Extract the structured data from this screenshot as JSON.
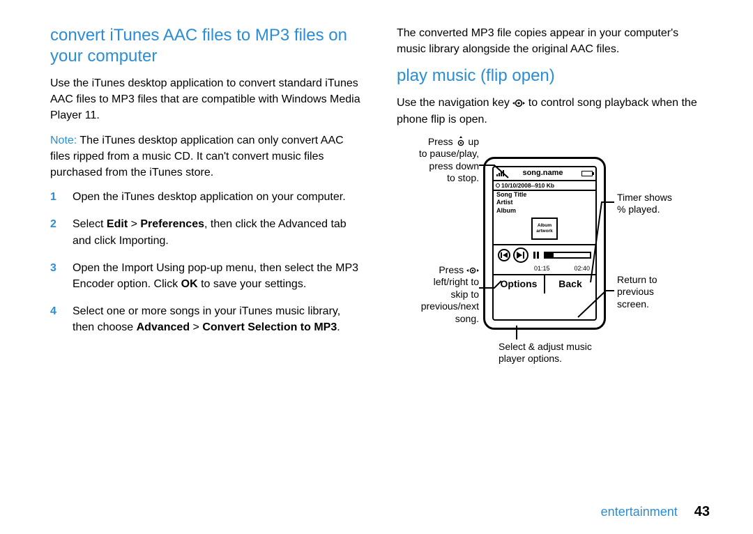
{
  "col_left": {
    "h2": "convert iTunes AAC files to MP3 files on your computer",
    "p1": "Use the iTunes desktop application to convert standard iTunes AAC files to MP3 files that are compatible with Windows Media Player 11.",
    "note_label": "Note:",
    "note_body": " The iTunes desktop application can only convert AAC files ripped from a music CD. It can't convert music files purchased from the iTunes store.",
    "steps": [
      {
        "num": "1",
        "html": "Open the iTunes desktop application on your computer."
      },
      {
        "num": "2",
        "html": "Select <b>Edit</b> > <b>Preferences</b>, then click the Advanced tab and click Importing."
      },
      {
        "num": "3",
        "html": "Open the Import Using pop-up menu, then select the MP3 Encoder option. Click <b>OK</b> to save your settings."
      },
      {
        "num": "4",
        "html": "Select one or more songs in your iTunes music library, then choose <b>Advanced</b> > <b>Convert Selection to MP3</b>."
      }
    ]
  },
  "col_right": {
    "p1": "The converted MP3 file copies appear in your computer's music library alongside the original AAC files.",
    "h2": "play music (flip open)",
    "p2a": "Use the navigation key ",
    "p2b": " to control song playback when the phone flip is open.",
    "callouts": {
      "up": "Press       up\nto pause/play,\npress down\nto stop.",
      "up_pre": "Press ",
      "up_post": " up",
      "up_l2": "to pause/play,",
      "up_l3": "press down",
      "up_l4": "to stop.",
      "leftright_pre": "Press ",
      "leftright_post": "",
      "leftright_l2": "left/right to",
      "leftright_l3": "skip to",
      "leftright_l4": "previous/next",
      "leftright_l5": "song.",
      "timer_l1": "Timer shows",
      "timer_l2": "% played.",
      "back_l1": "Return to",
      "back_l2": "previous",
      "back_l3": "screen.",
      "options_l1": "Select & adjust music",
      "options_l2": "player options."
    },
    "phone": {
      "title": "song.name",
      "date": "10/10/2008--910 Kb",
      "meta1": "Song Title",
      "meta2": "Artist",
      "meta3": "Album",
      "artwork": "Album artwork",
      "t_elapsed": "01:15",
      "t_total": "02:40",
      "soft_left": "Options",
      "soft_right": "Back"
    }
  },
  "footer": {
    "section": "entertainment",
    "page": "43"
  }
}
